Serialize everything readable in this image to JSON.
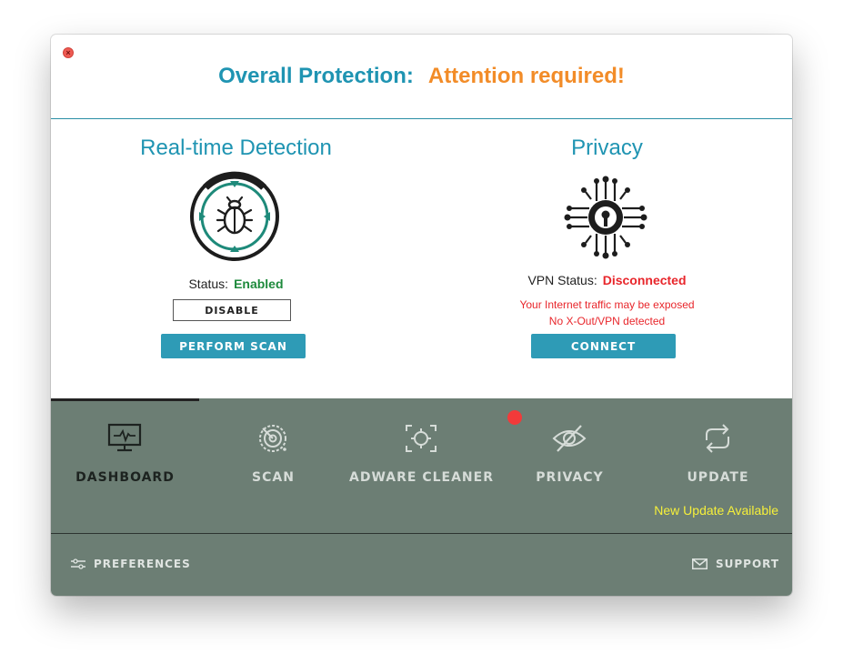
{
  "window": {
    "header_title": "Overall Protection:",
    "header_status": "Attention required!"
  },
  "realtime": {
    "title": "Real-time Detection",
    "status_label": "Status:",
    "status_value": "Enabled",
    "disable_label": "DISABLE",
    "scan_label": "PERFORM SCAN",
    "icon": "bug-shield-icon"
  },
  "privacy": {
    "title": "Privacy",
    "vpn_label": "VPN Status:",
    "vpn_value": "Disconnected",
    "warning_1": "Your Internet traffic may be exposed",
    "warning_2": "No X-Out/VPN detected",
    "connect_label": "CONNECT",
    "icon": "circuit-lock-icon"
  },
  "nav": {
    "items": [
      {
        "label": "DASHBOARD",
        "icon": "monitor-pulse-icon",
        "active": true
      },
      {
        "label": "SCAN",
        "icon": "radar-icon",
        "active": false
      },
      {
        "label": "ADWARE CLEANER",
        "icon": "crosshair-icon",
        "active": false
      },
      {
        "label": "PRIVACY",
        "icon": "eye-slash-icon",
        "active": false
      },
      {
        "label": "UPDATE",
        "icon": "refresh-icon",
        "active": false
      }
    ],
    "update_note": "New Update Available"
  },
  "footer": {
    "preferences_label": "PREFERENCES",
    "support_label": "SUPPORT"
  },
  "colors": {
    "accent": "#1f94b2",
    "warning": "#f28c28",
    "danger": "#e8262b",
    "success": "#1e8a3c",
    "nav_bg": "#6c7e74",
    "update_note": "#f6f03a"
  }
}
